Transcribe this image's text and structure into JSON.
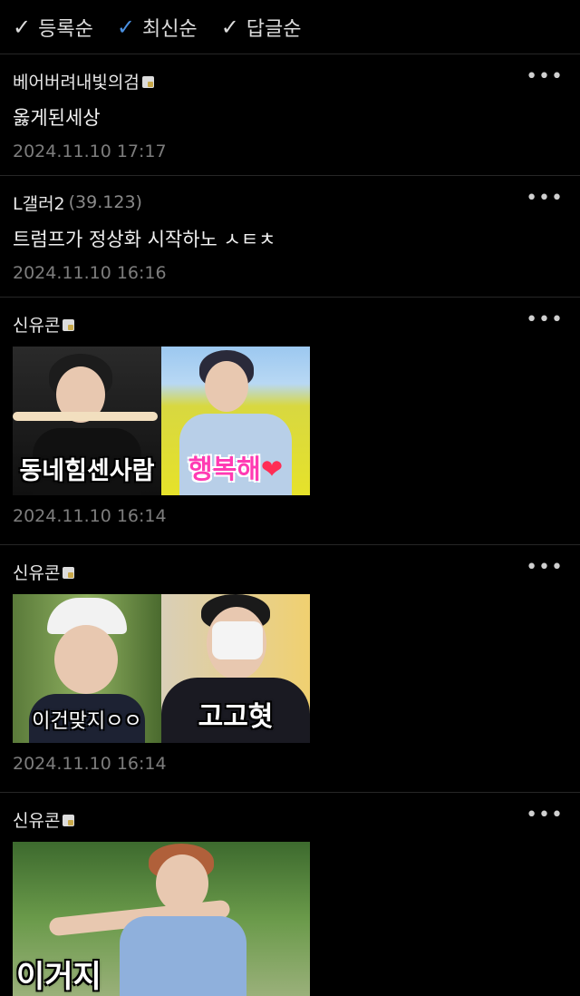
{
  "sort": [
    {
      "label": "등록순"
    },
    {
      "label": "최신순",
      "active": true
    },
    {
      "label": "답글순"
    }
  ],
  "comments": [
    {
      "author": "베어버려내빛의검",
      "text": "옳게된세상",
      "date": "2024.11.10 17:17"
    },
    {
      "author": "L갤러2",
      "ip": "(39.123)",
      "text": "트럼프가 정상화 시작하노 ㅅㅌㅊ",
      "date": "2024.11.10 16:16"
    },
    {
      "author": "신유콘",
      "captions": [
        "동네힘센사람",
        "행복해"
      ],
      "date": "2024.11.10 16:14"
    },
    {
      "author": "신유콘",
      "captions": [
        "이건맞지ㅇㅇ",
        "고고혓"
      ],
      "date": "2024.11.10 16:14"
    },
    {
      "author": "신유콘",
      "captions": [
        "이거지"
      ]
    }
  ],
  "more_label": "•••",
  "colors": {
    "accent": "#4a90e2",
    "check": "#dcdcdc"
  }
}
